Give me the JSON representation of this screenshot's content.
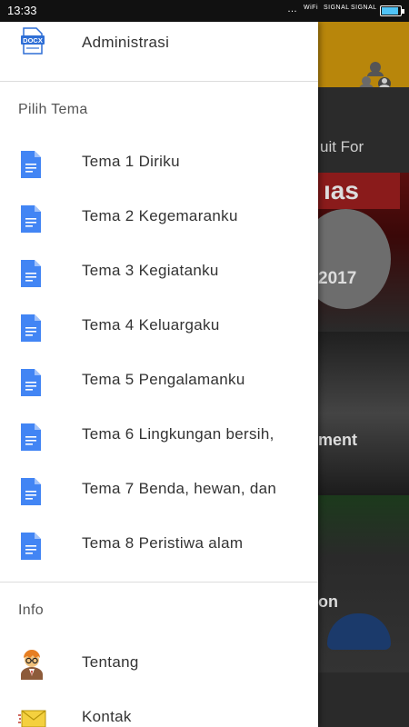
{
  "status_bar": {
    "time": "13:33",
    "dots": "…",
    "wifi_label": "WiFi",
    "signal1_label": "SIGNAL",
    "signal2_label": "SIGNAL",
    "battery_icon": "battery-icon",
    "battery_color": "#4fc3f7"
  },
  "drawer": {
    "top_item": {
      "label": "Administrasi",
      "icon": "docx-file-icon"
    },
    "theme_section": {
      "title": "Pilih Tema",
      "items": [
        {
          "label": "Tema 1 Diriku",
          "icon": "document-icon"
        },
        {
          "label": "Tema 2 Kegemaranku",
          "icon": "document-icon"
        },
        {
          "label": "Tema 3 Kegiatanku",
          "icon": "document-icon"
        },
        {
          "label": "Tema 4 Keluargaku",
          "icon": "document-icon"
        },
        {
          "label": "Tema 5 Pengalamanku",
          "icon": "document-icon"
        },
        {
          "label": "Tema 6 Lingkungan bersih,",
          "icon": "document-icon"
        },
        {
          "label": "Tema 7 Benda, hewan, dan",
          "icon": "document-icon"
        },
        {
          "label": "Tema 8 Peristiwa alam",
          "icon": "document-icon"
        }
      ]
    },
    "info_section": {
      "title": "Info",
      "items": [
        {
          "label": "Tentang",
          "icon": "person-glasses-icon"
        },
        {
          "label": "Kontak",
          "icon": "envelope-icon"
        }
      ]
    },
    "accent_color": "#4285f4"
  },
  "background": {
    "appbar_color": "#b8860b",
    "text1": "uit For",
    "text2": "2017",
    "text3": "ment",
    "text4": "on",
    "people_icon": "people-icon"
  }
}
